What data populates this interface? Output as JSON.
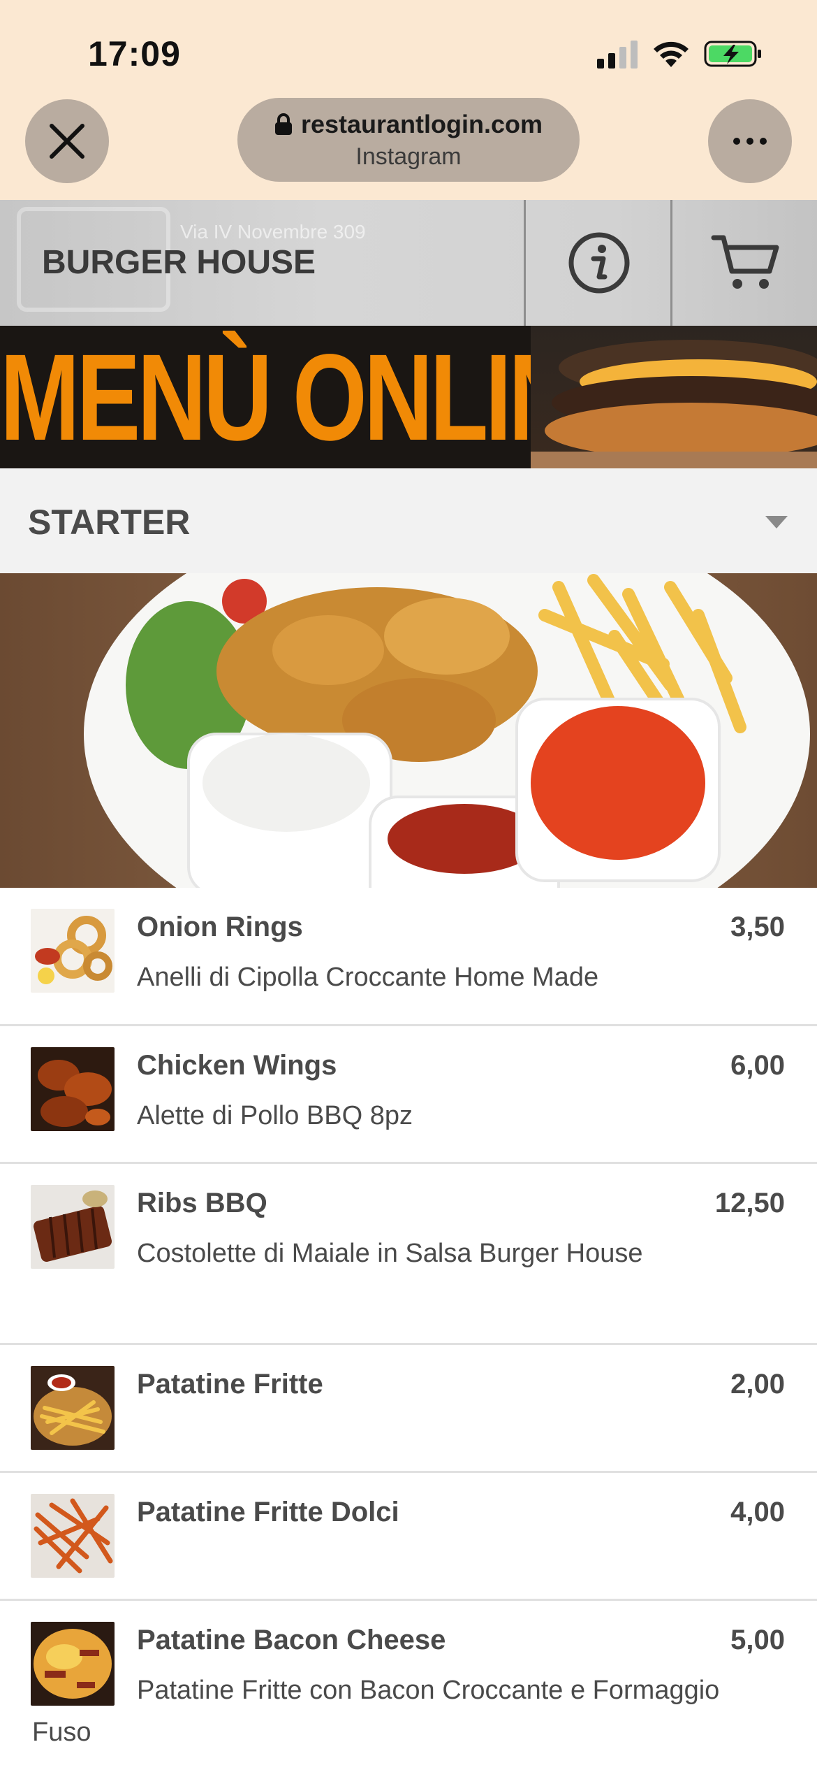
{
  "status_bar": {
    "time": "17:09"
  },
  "browser": {
    "url": "restaurantlogin.com",
    "subtitle": "Instagram",
    "icons": {
      "close": "close-icon",
      "lock": "lock-icon",
      "more": "more-icon"
    }
  },
  "header": {
    "brand": "BURGER HOUSE",
    "ghost_text": "Via IV Novembre 309",
    "icons": {
      "info": "info-icon",
      "cart": "cart-icon"
    }
  },
  "banner": {
    "title": "MENÙ ONLINE"
  },
  "section": {
    "title": "STARTER",
    "icon": "chevron-down-icon"
  },
  "menu": {
    "items": [
      {
        "name": "Onion Rings",
        "price": "3,50",
        "description": "Anelli di Cipolla Croccante Home Made"
      },
      {
        "name": "Chicken Wings",
        "price": "6,00",
        "description": "Alette di Pollo BBQ 8pz"
      },
      {
        "name": "Ribs BBQ",
        "price": "12,50",
        "description": "Costolette di Maiale in Salsa Burger House"
      },
      {
        "name": "Patatine Fritte",
        "price": "2,00",
        "description": ""
      },
      {
        "name": "Patatine Fritte Dolci",
        "price": "4,00",
        "description": ""
      },
      {
        "name": "Patatine Bacon Cheese",
        "price": "5,00",
        "description": "Patatine Fritte con Bacon Croccante e Formaggio Fuso"
      }
    ]
  },
  "colors": {
    "chrome_bg": "#fbe8d2",
    "pill_bg": "#b9aca0",
    "banner_orange": "#f18a06",
    "text": "#4a4a4a",
    "battery_green": "#4cd964"
  }
}
